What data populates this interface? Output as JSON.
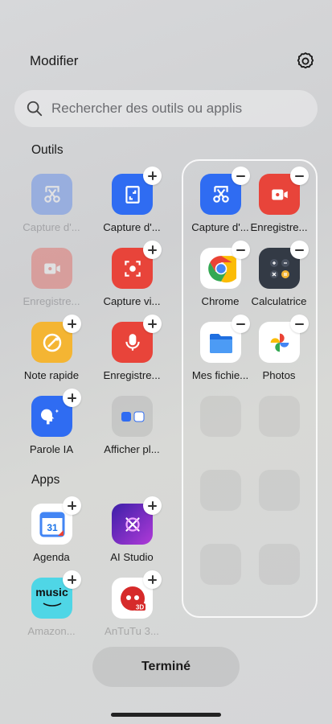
{
  "header": {
    "title": "Modifier"
  },
  "search": {
    "placeholder": "Rechercher des outils ou applis"
  },
  "sections": {
    "tools": "Outils",
    "apps": "Apps"
  },
  "tools": [
    {
      "label": "Capture d'...",
      "icon": "scissors-icon",
      "color": "#2f6cf2",
      "state": "added"
    },
    {
      "label": "Capture d'...",
      "icon": "screenshot-frame-icon",
      "color": "#2f6cf2",
      "state": "addable"
    },
    {
      "label": "Enregistre...",
      "icon": "video-record-icon",
      "color": "#e8443a",
      "state": "added"
    },
    {
      "label": "Capture vi...",
      "icon": "screen-capture-icon",
      "color": "#e8443a",
      "state": "addable"
    },
    {
      "label": "Note rapide",
      "icon": "quick-note-icon",
      "color": "#f4b533",
      "state": "addable"
    },
    {
      "label": "Enregistre...",
      "icon": "microphone-icon",
      "color": "#e8443a",
      "state": "addable"
    },
    {
      "label": "Parole IA",
      "icon": "ai-speech-icon",
      "color": "#2f6cf2",
      "state": "addable"
    },
    {
      "label": "Afficher pl...",
      "icon": "show-more-folder-icon",
      "color": "#c7c8ca",
      "state": "none"
    }
  ],
  "apps": [
    {
      "label": "Agenda",
      "icon": "calendar-icon",
      "color": "#ffffff",
      "day": "31",
      "state": "addable"
    },
    {
      "label": "AI Studio",
      "icon": "ai-studio-icon",
      "color": "#6a2fd6",
      "state": "addable"
    },
    {
      "label": "Amazon...",
      "icon": "amazon-music-icon",
      "color": "#4fd6e6",
      "brand": "music",
      "state": "addable"
    },
    {
      "label": "AnTuTu 3...",
      "icon": "antutu-icon",
      "color": "#ffffff",
      "tag": "3D",
      "state": "addable"
    }
  ],
  "selected": [
    {
      "label": "Capture d'...",
      "icon": "scissors-icon",
      "color": "#2f6cf2"
    },
    {
      "label": "Enregistre...",
      "icon": "video-record-icon",
      "color": "#e8443a"
    },
    {
      "label": "Chrome",
      "icon": "chrome-icon",
      "color": "#ffffff"
    },
    {
      "label": "Calculatrice",
      "icon": "calculator-icon",
      "color": "#333a45"
    },
    {
      "label": "Mes fichie...",
      "icon": "files-folder-icon",
      "color": "#ffffff"
    },
    {
      "label": "Photos",
      "icon": "photos-pinwheel-icon",
      "color": "#ffffff"
    }
  ],
  "footer": {
    "done_label": "Terminé"
  }
}
